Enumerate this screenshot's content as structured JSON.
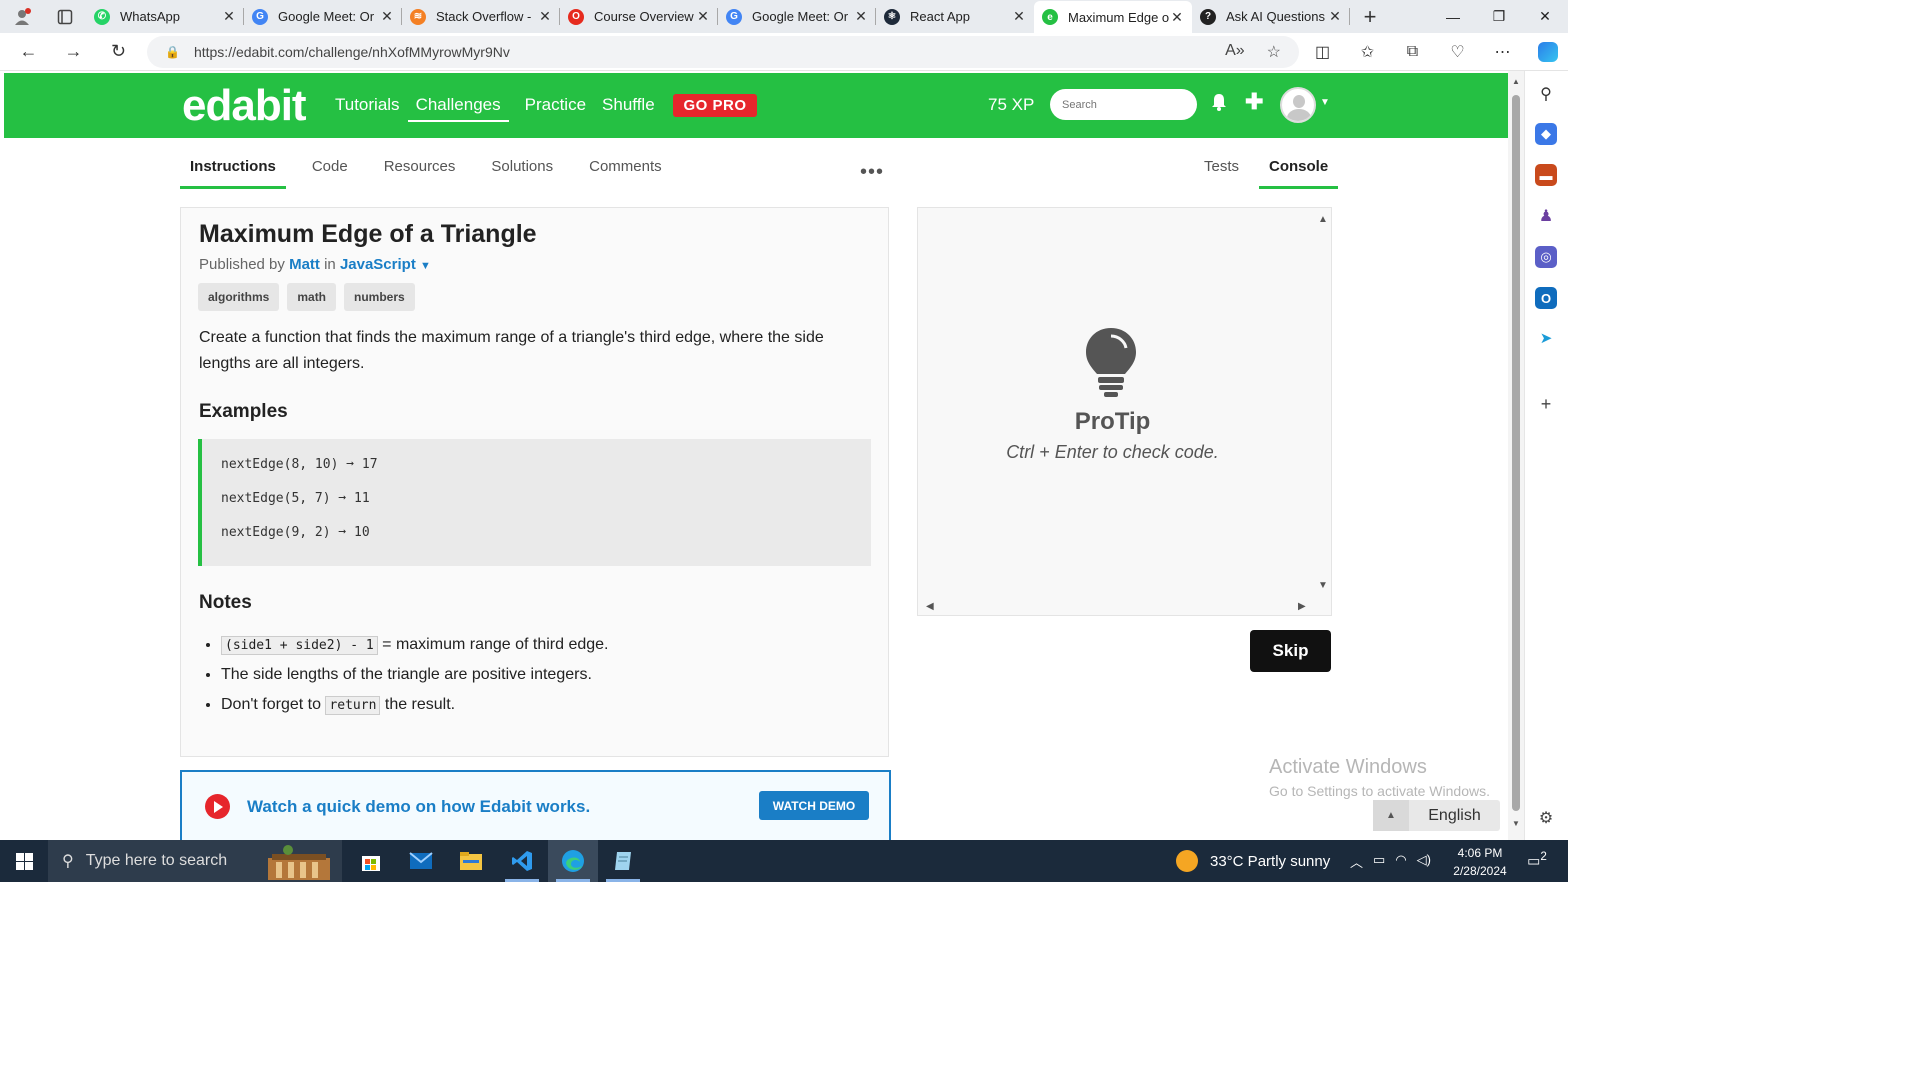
{
  "browser": {
    "tabs": [
      {
        "label": "WhatsApp",
        "color": "#25d366",
        "glyph": "✆"
      },
      {
        "label": "Google Meet: Or",
        "color": "#4285f4",
        "glyph": "G"
      },
      {
        "label": "Stack Overflow -",
        "color": "#f48024",
        "glyph": "≋"
      },
      {
        "label": "Course Overview",
        "color": "#e62b1e",
        "glyph": "O"
      },
      {
        "label": "Google Meet: Or",
        "color": "#4285f4",
        "glyph": "G"
      },
      {
        "label": "React App",
        "color": "#1e2a3a",
        "glyph": "⚛"
      },
      {
        "label": "Maximum Edge o",
        "color": "#25c043",
        "glyph": "e"
      },
      {
        "label": "Ask AI Questions",
        "color": "#222222",
        "glyph": "?"
      }
    ],
    "active_tab_index": 6,
    "url": "https://edabit.com/challenge/nhXofMMyrowMyr9Nv"
  },
  "site": {
    "logo": "edabit",
    "nav": [
      "Tutorials",
      "Challenges",
      "Practice",
      "Shuffle"
    ],
    "active_nav": "Challenges",
    "gopro": "GO PRO",
    "xp": "75 XP",
    "search_placeholder": "Search",
    "accent": "#25c043",
    "link_color": "#1a7ec6"
  },
  "subtabs": {
    "left": [
      "Instructions",
      "Code",
      "Resources",
      "Solutions",
      "Comments"
    ],
    "right": [
      "Tests",
      "Console"
    ],
    "more": "•••"
  },
  "challenge": {
    "title": "Maximum Edge of a Triangle",
    "published_by": "Published by",
    "author": "Matt",
    "in": "in",
    "language": "JavaScript",
    "tags": [
      "algorithms",
      "math",
      "numbers"
    ],
    "description": "Create a function that finds the maximum range of a triangle's third edge, where the side lengths are all integers.",
    "examples_heading": "Examples",
    "examples": [
      "nextEdge(8, 10) ➞ 17",
      "nextEdge(5, 7) ➞ 11",
      "nextEdge(9, 2) ➞ 10"
    ],
    "notes_heading": "Notes",
    "note1_code": "(side1 + side2) - 1",
    "note1_text": " = maximum range of third edge.",
    "note2": "The side lengths of the triangle are positive integers.",
    "note3_pre": "Don't forget to ",
    "note3_code": "return",
    "note3_post": " the result."
  },
  "console": {
    "protip": "ProTip",
    "protip_text": "Ctrl + Enter to check code."
  },
  "skip": "Skip",
  "demo": {
    "text": "Watch a quick demo on how Edabit works.",
    "button": "WATCH DEMO"
  },
  "activate": {
    "title": "Activate Windows",
    "sub": "Go to Settings to activate Windows."
  },
  "language_selector": "English",
  "taskbar": {
    "search_placeholder": "Type here to search",
    "weather": "33°C  Partly sunny",
    "time": "4:06 PM",
    "date": "2/28/2024",
    "notifications": "2"
  }
}
